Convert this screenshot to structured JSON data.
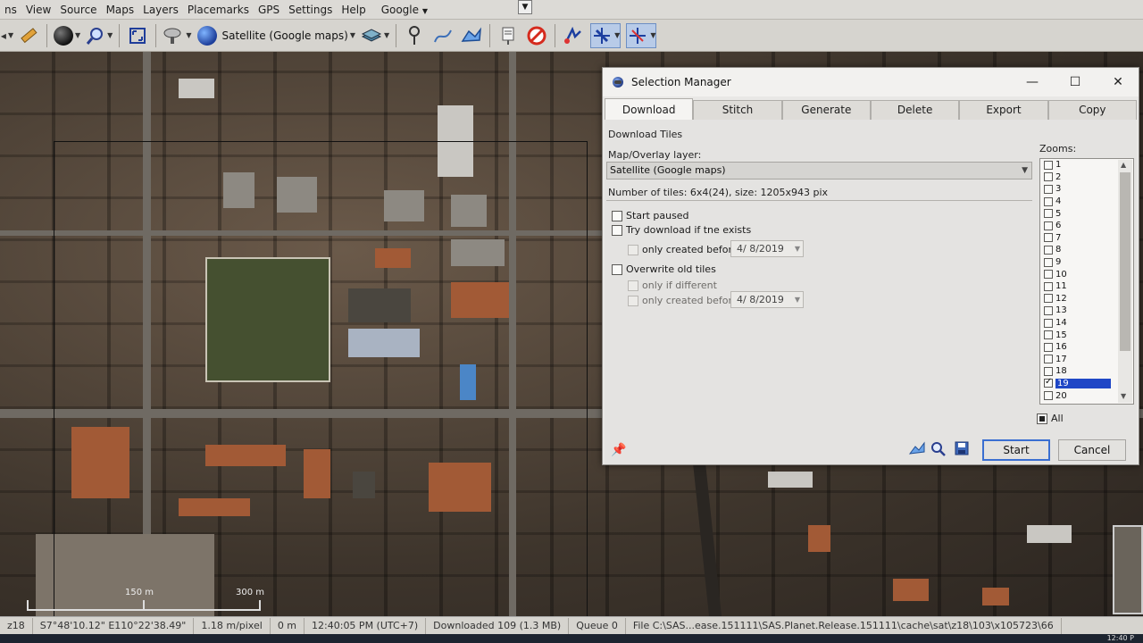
{
  "menubar": {
    "items": [
      "ns",
      "View",
      "Source",
      "Maps",
      "Layers",
      "Placemarks",
      "GPS",
      "Settings",
      "Help"
    ],
    "google_menu": "Google"
  },
  "toolbar": {
    "map_source": "Satellite (Google maps)"
  },
  "map": {
    "scale_labels": [
      "150 m",
      "300 m"
    ]
  },
  "statusbar": {
    "zoom": "z18",
    "coordinates": "S7°48'10.12\" E110°22'38.49\"",
    "resolution": "1.18 m/pixel",
    "distance": "0 m",
    "time": "12:40:05 PM (UTC+7)",
    "downloaded": "Downloaded 109 (1.3 MB)",
    "queue": "Queue 0",
    "file": "File C:\\SAS...ease.151111\\SAS.Planet.Release.151111\\cache\\sat\\z18\\103\\x105723\\66"
  },
  "taskbar": {
    "clock": "12:40 P"
  },
  "dialog": {
    "title": "Selection Manager",
    "tabs": [
      "Download",
      "Stitch",
      "Generate",
      "Delete",
      "Export",
      "Copy"
    ],
    "active_tab": "Download",
    "section_title": "Download Tiles",
    "layer_label": "Map/Overlay layer:",
    "layer_value": "Satellite (Google maps)",
    "tiles_info": "Number of tiles: 6x4(24), size: 1205x943 pix",
    "options": {
      "start_paused": "Start paused",
      "try_download": "Try download if tne exists",
      "only_created_before_1": "only created before",
      "date_1": "4/ 8/2019",
      "overwrite": "Overwrite old tiles",
      "only_if_different": "only if different",
      "only_created_before_2": "only created before",
      "date_2": "4/ 8/2019"
    },
    "zooms_label": "Zooms:",
    "zooms": [
      "1",
      "2",
      "3",
      "4",
      "5",
      "6",
      "7",
      "8",
      "9",
      "10",
      "11",
      "12",
      "13",
      "14",
      "15",
      "16",
      "17",
      "18",
      "19",
      "20"
    ],
    "selected_zoom": "19",
    "all_label": "All",
    "start_button": "Start",
    "cancel_button": "Cancel"
  },
  "colors": {
    "selection_highlight": "#1f47c6",
    "default_button_border": "#3a6fd1"
  }
}
